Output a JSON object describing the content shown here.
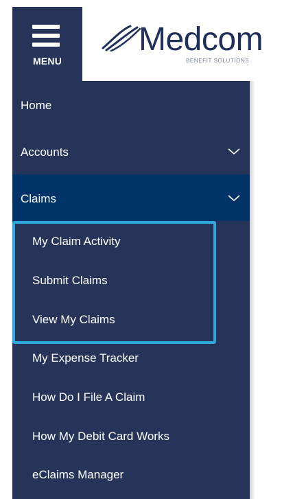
{
  "header": {
    "menu_label": "MENU",
    "logo_text": "Medcom",
    "logo_subtext": "BENEFIT SOLUTIONS"
  },
  "nav": {
    "items": [
      {
        "label": "Home"
      },
      {
        "label": "Accounts",
        "icon": "chevron-down-icon"
      },
      {
        "label": "Claims",
        "icon": "chevron-down-icon",
        "active": true
      }
    ],
    "claims_subitems": [
      {
        "label": "My Claim Activity"
      },
      {
        "label": "Submit Claims"
      },
      {
        "label": "View My Claims"
      },
      {
        "label": "My Expense Tracker"
      },
      {
        "label": "How Do I File A Claim"
      },
      {
        "label": "How My Debit Card Works"
      },
      {
        "label": "eClaims Manager"
      }
    ]
  },
  "colors": {
    "sidebar_bg": "#27345a",
    "active_bg": "#003468",
    "highlight_border": "#2fa6dc",
    "logo_text": "#20305a"
  }
}
